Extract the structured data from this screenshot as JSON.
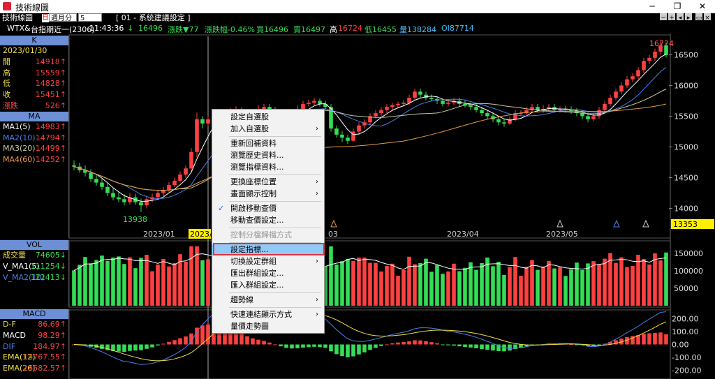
{
  "window": {
    "title": "技術線圖",
    "minimize": "─",
    "restore": "❐",
    "close": "✕"
  },
  "toolbar": {
    "label": "技術線圖",
    "red_tag": "日",
    "period": "週月分",
    "count": "5",
    "preset": "[ 01 - 系統建議設定 ]"
  },
  "quote": {
    "symbol": "WTX&",
    "name": "台指期近一(2306)",
    "time": "11:43:36",
    "arrow": "↓",
    "last": "16496",
    "change_label": "漲跌▼77",
    "pct_label": "漲跌幅-0.46%",
    "bid_label": "買16496",
    "ask_label": "賣16497",
    "high_label": "高",
    "high": "16724",
    "low_label": "低16455",
    "vol_label": "量138284",
    "oi_label": "OI87714"
  },
  "k_panel": {
    "header": "K",
    "date": "2023/01/30",
    "rows": [
      {
        "k": "開",
        "v": "14918↑"
      },
      {
        "k": "高",
        "v": "15559↑"
      },
      {
        "k": "低",
        "v": "14828↑"
      },
      {
        "k": "收",
        "v": "15451↑"
      },
      {
        "k": "漲跌",
        "v": "526↑"
      }
    ]
  },
  "ma_panel": {
    "header": "MA",
    "rows": [
      {
        "k": "MA1(5)",
        "v": "14983↑"
      },
      {
        "k": "MA2(10)",
        "v": "14794↑"
      },
      {
        "k": "MA3(20)",
        "v": "14499↑"
      },
      {
        "k": "MA4(60)",
        "v": "14252↑"
      }
    ]
  },
  "vol_panel": {
    "header": "VOL",
    "rows": [
      {
        "k": "成交量",
        "v": "74605↓"
      },
      {
        "k": "V_MA1(5)",
        "v": "111254↓"
      },
      {
        "k": "V_MA2(10)",
        "v": "122413↓"
      }
    ]
  },
  "macd_panel": {
    "header": "MACD",
    "rows": [
      {
        "k": "D-F",
        "v": "86.69↑"
      },
      {
        "k": "MACD",
        "v": "98.29↑"
      },
      {
        "k": "DIF",
        "v": "184.97↑"
      },
      {
        "k": "EMA(12)",
        "v": "14767.55↑"
      },
      {
        "k": "EMA(26)",
        "v": "14582.57↑"
      }
    ]
  },
  "price_axis": [
    "16500",
    "16000",
    "15500",
    "15000",
    "14500",
    "14000"
  ],
  "current_price_tag": "13353",
  "peak_label": "16724",
  "low_label": "13938",
  "date_axis": [
    "2023/01",
    "2023/0",
    "03",
    "2023/04",
    "2023/05"
  ],
  "vol_axis": [
    "150000",
    "100000",
    "50000"
  ],
  "macd_axis": [
    "200.00",
    "100.00",
    "0.00",
    "-100.00",
    "-200.00"
  ],
  "context_menu": {
    "items": [
      {
        "label": "設定自選股",
        "arrow": false
      },
      {
        "label": "加入自選股",
        "arrow": true
      },
      {
        "label": "重新回補資料",
        "arrow": false
      },
      {
        "label": "瀏覽歷史資料...",
        "arrow": false
      },
      {
        "label": "瀏覽指標資料...",
        "arrow": false
      },
      {
        "label": "更換座標位置",
        "arrow": true
      },
      {
        "label": "畫面顯示控制",
        "arrow": true
      },
      {
        "label": "開啟移動查價",
        "arrow": false,
        "checked": true
      },
      {
        "label": "移動查價設定...",
        "arrow": false
      },
      {
        "label": "控制分檔歸檔方式",
        "arrow": false,
        "disabled": true
      },
      {
        "label": "設定指標...",
        "arrow": false,
        "highlighted": true
      },
      {
        "label": "切換設定群組",
        "arrow": true
      },
      {
        "label": "匯出群組設定...",
        "arrow": false
      },
      {
        "label": "匯入群組設定...",
        "arrow": false
      },
      {
        "label": "趨勢線",
        "arrow": true
      },
      {
        "label": "快速連結顯示方式",
        "arrow": true
      },
      {
        "label": "量價走勢圖",
        "arrow": false
      }
    ],
    "arrow_glyph": "›",
    "check_glyph": "✓"
  },
  "colors": {
    "up": "#ff4040",
    "down": "#33dd55",
    "ma5": "#ffffff",
    "ma10": "#4a7fe6",
    "ma20": "#c8c8a0",
    "ma60": "#e89a40",
    "highlight_border": "#d9363e"
  },
  "chart_data": [
    {
      "type": "candlestick",
      "title": "",
      "ylim": [
        13700,
        16800
      ],
      "x": [
        "2022/12/19",
        "2022/12/20",
        "2022/12/21",
        "2022/12/22",
        "2022/12/23",
        "2022/12/26",
        "2022/12/27",
        "2022/12/28",
        "2022/12/29",
        "2022/12/30",
        "2023/01/03",
        "2023/01/04",
        "2023/01/05",
        "2023/01/06",
        "2023/01/09",
        "2023/01/10",
        "2023/01/11",
        "2023/01/12",
        "2023/01/13",
        "2023/01/16",
        "2023/01/17",
        "2023/01/18",
        "2023/01/30",
        "2023/01/31",
        "2023/02/01",
        "2023/02/02",
        "2023/02/03",
        "2023/02/06",
        "2023/02/07",
        "2023/02/08",
        "2023/02/09",
        "2023/02/10",
        "2023/02/13",
        "2023/02/14",
        "2023/02/15",
        "2023/02/16",
        "2023/02/17",
        "2023/02/20",
        "2023/02/21",
        "2023/02/22",
        "2023/02/23",
        "2023/02/24",
        "2023/03/01",
        "2023/03/02",
        "2023/03/03",
        "2023/03/06",
        "2023/03/07",
        "2023/03/08",
        "2023/03/09",
        "2023/03/10",
        "2023/03/13",
        "2023/03/14",
        "2023/03/15",
        "2023/03/16",
        "2023/03/17",
        "2023/03/20",
        "2023/03/21",
        "2023/03/22",
        "2023/03/23",
        "2023/03/24",
        "2023/03/27",
        "2023/03/28",
        "2023/03/29",
        "2023/03/30",
        "2023/03/31",
        "2023/04/06",
        "2023/04/07",
        "2023/04/10",
        "2023/04/11",
        "2023/04/12",
        "2023/04/13",
        "2023/04/14",
        "2023/04/17",
        "2023/04/18",
        "2023/04/19",
        "2023/04/20",
        "2023/04/21",
        "2023/04/24",
        "2023/04/25",
        "2023/04/26",
        "2023/04/27",
        "2023/04/28",
        "2023/05/02",
        "2023/05/03",
        "2023/05/04",
        "2023/05/05",
        "2023/05/08",
        "2023/05/09",
        "2023/05/10",
        "2023/05/11",
        "2023/05/12",
        "2023/05/15",
        "2023/05/16",
        "2023/05/17",
        "2023/05/18",
        "2023/05/19",
        "2023/05/22",
        "2023/05/23",
        "2023/05/24",
        "2023/05/25",
        "2023/05/26",
        "2023/05/29",
        "2023/05/30",
        "2023/05/31",
        "2023/06/01",
        "2023/06/02",
        "2023/06/05"
      ],
      "open": [
        14700,
        14680,
        14620,
        14580,
        14480,
        14420,
        14350,
        14250,
        14180,
        14150,
        14100,
        14180,
        14100,
        14050,
        14150,
        14180,
        14250,
        14300,
        14380,
        14450,
        14550,
        14650,
        14918,
        15451,
        15380,
        15450,
        15500,
        15450,
        15520,
        15580,
        15600,
        15560,
        15500,
        15550,
        15620,
        15650,
        15600,
        15550,
        15500,
        15480,
        15550,
        15620,
        15700,
        15720,
        15750,
        15700,
        15650,
        15300,
        15200,
        15150,
        15100,
        15250,
        15350,
        15400,
        15500,
        15550,
        15600,
        15650,
        15680,
        15700,
        15720,
        15800,
        15900,
        15850,
        15800,
        15780,
        15750,
        15700,
        15720,
        15750,
        15700,
        15680,
        15650,
        15600,
        15550,
        15500,
        15450,
        15400,
        15380,
        15450,
        15550,
        15550,
        15600,
        15650,
        15600,
        15620,
        15650,
        15600,
        15620,
        15600,
        15580,
        15550,
        15500,
        15450,
        15500,
        15600,
        15700,
        15800,
        15900,
        16000,
        16100,
        16150,
        16250,
        16400,
        16450,
        16550,
        16650
      ],
      "close": [
        14680,
        14620,
        14580,
        14480,
        14420,
        14350,
        14250,
        14180,
        14150,
        14100,
        14180,
        14100,
        14050,
        14150,
        14180,
        14250,
        14300,
        14380,
        14450,
        14550,
        14650,
        14918,
        15451,
        15380,
        15450,
        15500,
        15450,
        15520,
        15580,
        15600,
        15560,
        15500,
        15550,
        15620,
        15650,
        15600,
        15550,
        15500,
        15480,
        15550,
        15620,
        15700,
        15720,
        15750,
        15700,
        15650,
        15300,
        15200,
        15150,
        15100,
        15250,
        15350,
        15400,
        15500,
        15550,
        15600,
        15650,
        15680,
        15700,
        15720,
        15800,
        15900,
        15850,
        15800,
        15780,
        15750,
        15700,
        15720,
        15750,
        15700,
        15680,
        15650,
        15600,
        15550,
        15500,
        15450,
        15400,
        15380,
        15450,
        15550,
        15550,
        15600,
        15650,
        15600,
        15620,
        15650,
        15600,
        15620,
        15600,
        15580,
        15550,
        15500,
        15450,
        15500,
        15600,
        15700,
        15800,
        15900,
        16000,
        16100,
        16150,
        16250,
        16400,
        16450,
        16550,
        16650,
        16496
      ],
      "high": [
        14780,
        14740,
        14700,
        14640,
        14560,
        14480,
        14420,
        14330,
        14260,
        14230,
        14250,
        14240,
        14160,
        14200,
        14240,
        14300,
        14350,
        14430,
        14500,
        14600,
        14700,
        14980,
        15559,
        15500,
        15500,
        15560,
        15560,
        15580,
        15630,
        15660,
        15640,
        15600,
        15620,
        15680,
        15700,
        15700,
        15650,
        15600,
        15560,
        15600,
        15680,
        15750,
        15770,
        15800,
        15790,
        15750,
        15700,
        15350,
        15260,
        15200,
        15300,
        15400,
        15450,
        15550,
        15600,
        15650,
        15700,
        15720,
        15740,
        15760,
        15850,
        15950,
        15950,
        15900,
        15850,
        15820,
        15790,
        15760,
        15800,
        15800,
        15760,
        15720,
        15700,
        15650,
        15600,
        15560,
        15500,
        15450,
        15500,
        15600,
        15600,
        15650,
        15700,
        15700,
        15680,
        15700,
        15700,
        15660,
        15670,
        15660,
        15630,
        15600,
        15560,
        15550,
        15650,
        15750,
        15850,
        15950,
        16050,
        16150,
        16200,
        16300,
        16450,
        16500,
        16600,
        16724,
        16700
      ],
      "low": [
        14620,
        14580,
        14520,
        14430,
        14370,
        14300,
        14200,
        14130,
        14100,
        14050,
        14060,
        14060,
        13938,
        14000,
        14100,
        14150,
        14200,
        14260,
        14350,
        14420,
        14500,
        14600,
        14828,
        15300,
        15340,
        15400,
        15400,
        15420,
        15480,
        15530,
        15500,
        15450,
        15460,
        15500,
        15580,
        15560,
        15500,
        15440,
        15420,
        15440,
        15500,
        15580,
        15660,
        15680,
        15660,
        15600,
        15250,
        15150,
        15080,
        15050,
        15080,
        15200,
        15300,
        15360,
        15460,
        15500,
        15550,
        15600,
        15640,
        15660,
        15680,
        15760,
        15800,
        15760,
        15740,
        15700,
        15660,
        15660,
        15680,
        15660,
        15640,
        15600,
        15560,
        15500,
        15450,
        15400,
        15350,
        15330,
        15360,
        15420,
        15500,
        15520,
        15560,
        15560,
        15560,
        15580,
        15560,
        15560,
        15560,
        15540,
        15500,
        15450,
        15400,
        15420,
        15460,
        15560,
        15660,
        15760,
        15860,
        15960,
        16050,
        16100,
        16200,
        16350,
        16400,
        16500,
        16455
      ],
      "series": [
        {
          "name": "MA1(5)"
        },
        {
          "name": "MA2(10)"
        },
        {
          "name": "MA3(20)"
        },
        {
          "name": "MA4(60)"
        }
      ]
    },
    {
      "type": "bar",
      "title": "",
      "ylim": [
        0,
        180000
      ],
      "series": [
        {
          "name": "成交量"
        },
        {
          "name": "V_MA1(5)"
        },
        {
          "name": "V_MA2(10)"
        }
      ]
    },
    {
      "type": "bar",
      "title": "",
      "ylim": [
        -250,
        250
      ],
      "series": [
        {
          "name": "D-F"
        },
        {
          "name": "MACD"
        },
        {
          "name": "DIF"
        }
      ]
    }
  ]
}
